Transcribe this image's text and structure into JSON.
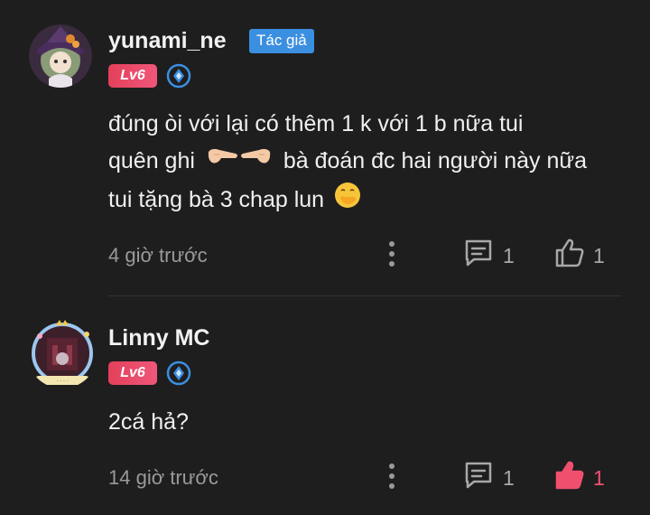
{
  "comments": [
    {
      "username": "yunami_ne",
      "author_badge": "Tác giả",
      "level": "Lv6",
      "content": {
        "line1": "đúng òi với lại có thêm 1 k với 1 b nữa tui",
        "line2a": "quên ghi",
        "line2b": "bà đoán đc hai người này nữa",
        "line3": "tui tặng bà 3 chap lun"
      },
      "timestamp": "4 giờ trước",
      "reply_count": "1",
      "like_count": "1",
      "liked": false
    },
    {
      "username": "Linny MC",
      "level": "Lv6",
      "content": {
        "line1": "2cá hả?"
      },
      "timestamp": "14 giờ trước",
      "reply_count": "1",
      "like_count": "1",
      "liked": true
    }
  ],
  "colors": {
    "background": "#1e1e1f",
    "author_badge": "#3b8fe0",
    "level_badge": "#e4405a",
    "liked": "#f0506e",
    "muted": "#9a9a9a"
  },
  "icons": {
    "more": "more-vertical-icon",
    "reply": "reply-bubble-icon",
    "like": "thumbs-up-icon",
    "rank": "rank-diamond-icon"
  }
}
